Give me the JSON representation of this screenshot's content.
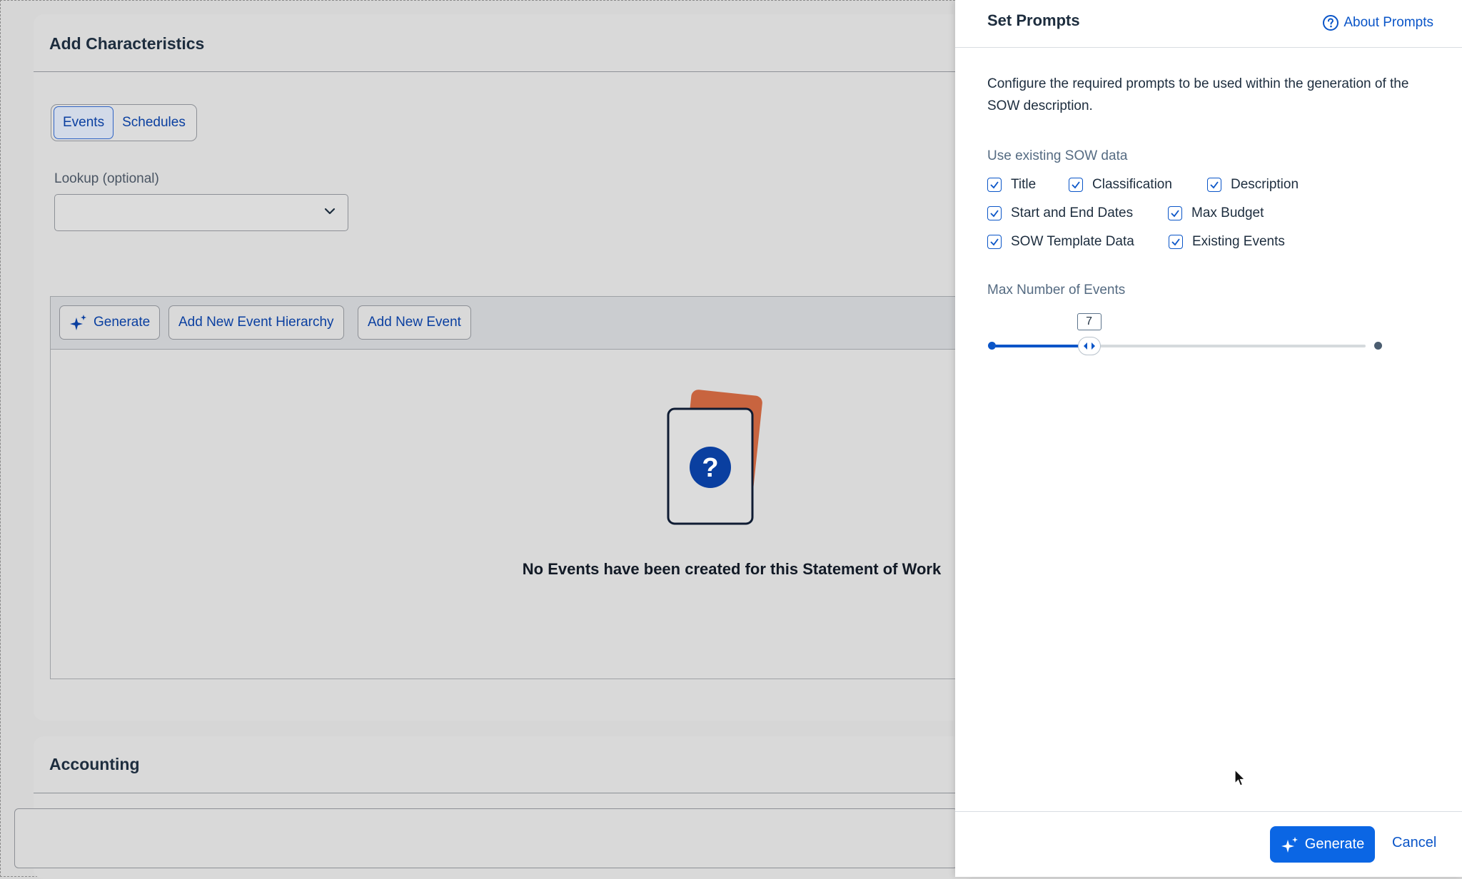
{
  "main_card": {
    "title": "Add Characteristics",
    "tabs": [
      {
        "label": "Events",
        "active": true
      },
      {
        "label": "Schedules",
        "active": false
      }
    ],
    "lookup": {
      "label": "Lookup (optional)",
      "value": ""
    },
    "toolbar": {
      "generate_label": "Generate",
      "add_hierarchy_label": "Add New Event Hierarchy",
      "add_event_label": "Add New Event"
    },
    "empty_state": {
      "message": "No Events have been created for this Statement of Work"
    }
  },
  "accounting_card": {
    "title": "Accounting"
  },
  "dialog": {
    "title": "Set Prompts",
    "about_link": "About Prompts",
    "description": "Configure the required prompts to be used within the generation of the SOW description.",
    "sow_data_label": "Use existing SOW data",
    "checkboxes": [
      {
        "label": "Title",
        "checked": true
      },
      {
        "label": "Classification",
        "checked": true
      },
      {
        "label": "Description",
        "checked": true
      },
      {
        "label": "Start and End Dates",
        "checked": true
      },
      {
        "label": "Max Budget",
        "checked": true
      },
      {
        "label": "SOW Template Data",
        "checked": true
      },
      {
        "label": "Existing Events",
        "checked": true
      }
    ],
    "max_events": {
      "label": "Max Number of Events",
      "value": "7",
      "fraction": 0.255
    },
    "footer": {
      "generate_label": "Generate",
      "cancel_label": "Cancel"
    }
  },
  "colors": {
    "accent": "#0b66e4",
    "link": "#0a55c8",
    "empty_card_back": "#c8643f",
    "empty_icon": "#0a3fa0"
  }
}
